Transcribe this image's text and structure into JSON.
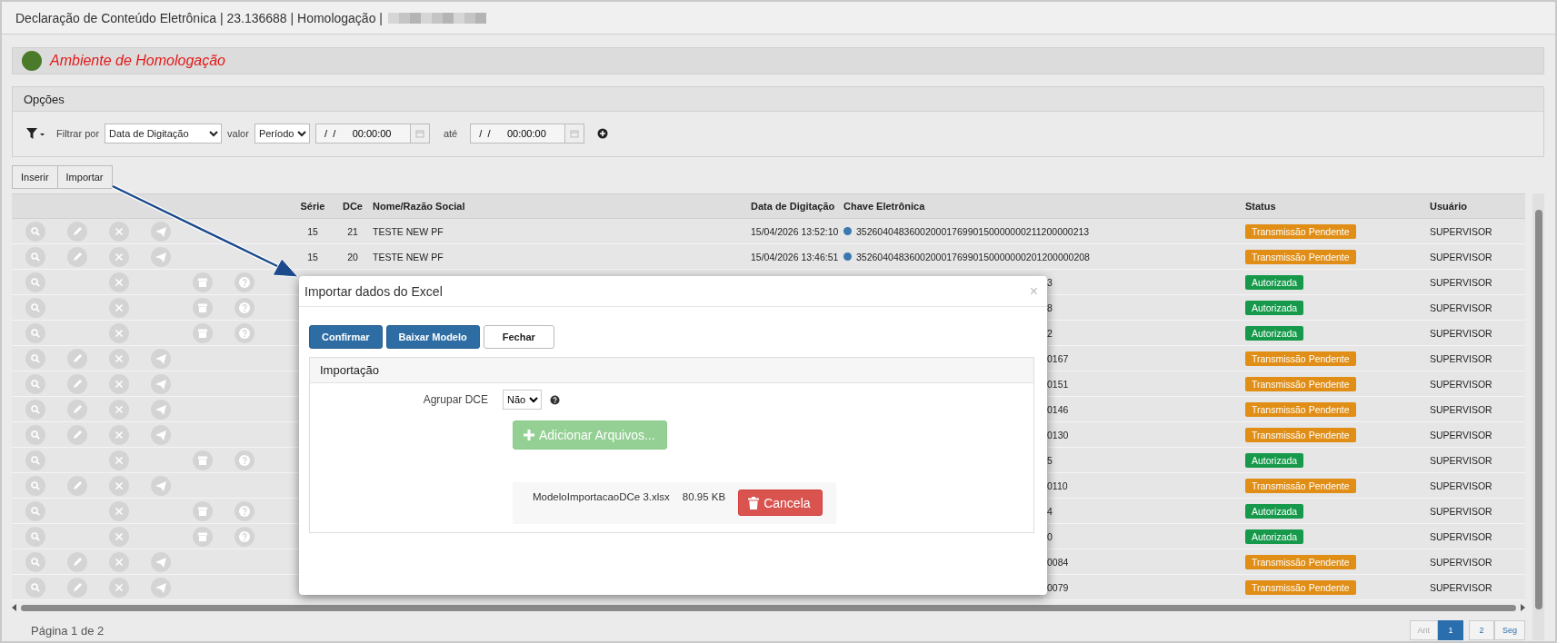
{
  "window": {
    "title": "Declaração de Conteúdo Eletrônica | 23.136688 | Homologação |"
  },
  "environment": {
    "label": "Ambiente de Homologação"
  },
  "options": {
    "title": "Opções",
    "filter_label": "Filtrar por",
    "filter_field": "Data de Digitação",
    "value_label": "valor",
    "value_mode": "Período",
    "from_value": "   /  /      00:00:00",
    "to_label": "até",
    "to_value": "   /  /      00:00:00"
  },
  "toolbar": [
    "Inserir",
    "Importar"
  ],
  "table": {
    "columns": [
      "Série",
      "DCe",
      "Nome/Razão Social",
      "Data de Digitação",
      "Chave Eletrônica",
      "Status",
      "Usuário"
    ],
    "rows": [
      {
        "actions": [
          {
            "kind": "search"
          },
          {
            "kind": "edit"
          },
          {
            "kind": "cancel"
          },
          {
            "kind": "send"
          }
        ],
        "serie": "15",
        "dce": "21",
        "name": "TESTE NEW PF",
        "date": "15/04/2026 13:52:10",
        "key": "35260404836002000176990150000000211200000213",
        "status": {
          "label": "Transmissão Pendente",
          "color": "#e08e16"
        },
        "user": "SUPERVISOR"
      },
      {
        "actions": [
          {
            "kind": "search"
          },
          {
            "kind": "edit"
          },
          {
            "kind": "cancel"
          },
          {
            "kind": "send"
          }
        ],
        "serie": "15",
        "dce": "20",
        "name": "TESTE NEW PF",
        "date": "15/04/2026 13:46:51",
        "key": "35260404836002000176990150000000201200000208",
        "status": {
          "label": "Transmissão Pendente",
          "color": "#e08e16"
        },
        "user": "SUPERVISOR"
      },
      {
        "actions": [
          {
            "kind": "search"
          },
          {
            "kind": "cancel"
          },
          {
            "kind": "archive"
          },
          {
            "kind": "help"
          }
        ],
        "key_tail": "3",
        "status": {
          "label": "Autorizada",
          "color": "#17994b"
        },
        "user": "SUPERVISOR"
      },
      {
        "actions": [
          {
            "kind": "search"
          },
          {
            "kind": "cancel"
          },
          {
            "kind": "archive"
          },
          {
            "kind": "help"
          }
        ],
        "key_tail": "8",
        "status": {
          "label": "Autorizada",
          "color": "#17994b"
        },
        "user": "SUPERVISOR"
      },
      {
        "actions": [
          {
            "kind": "search"
          },
          {
            "kind": "cancel"
          },
          {
            "kind": "archive"
          },
          {
            "kind": "help"
          }
        ],
        "key_tail": "2",
        "status": {
          "label": "Autorizada",
          "color": "#17994b"
        },
        "user": "SUPERVISOR"
      },
      {
        "actions": [
          {
            "kind": "search"
          },
          {
            "kind": "edit"
          },
          {
            "kind": "cancel"
          },
          {
            "kind": "send"
          }
        ],
        "key_tail": "0167",
        "status": {
          "label": "Transmissão Pendente",
          "color": "#e08e16"
        },
        "user": "SUPERVISOR"
      },
      {
        "actions": [
          {
            "kind": "search"
          },
          {
            "kind": "edit"
          },
          {
            "kind": "cancel"
          },
          {
            "kind": "send"
          }
        ],
        "key_tail": "0151",
        "status": {
          "label": "Transmissão Pendente",
          "color": "#e08e16"
        },
        "user": "SUPERVISOR"
      },
      {
        "actions": [
          {
            "kind": "search"
          },
          {
            "kind": "edit"
          },
          {
            "kind": "cancel"
          },
          {
            "kind": "send"
          }
        ],
        "key_tail": "0146",
        "status": {
          "label": "Transmissão Pendente",
          "color": "#e08e16"
        },
        "user": "SUPERVISOR"
      },
      {
        "actions": [
          {
            "kind": "search"
          },
          {
            "kind": "edit"
          },
          {
            "kind": "cancel"
          },
          {
            "kind": "send"
          }
        ],
        "key_tail": "0130",
        "status": {
          "label": "Transmissão Pendente",
          "color": "#e08e16"
        },
        "user": "SUPERVISOR"
      },
      {
        "actions": [
          {
            "kind": "search"
          },
          {
            "kind": "cancel"
          },
          {
            "kind": "archive"
          },
          {
            "kind": "help"
          }
        ],
        "key_tail": "5",
        "status": {
          "label": "Autorizada",
          "color": "#17994b"
        },
        "user": "SUPERVISOR"
      },
      {
        "actions": [
          {
            "kind": "search"
          },
          {
            "kind": "edit"
          },
          {
            "kind": "cancel"
          },
          {
            "kind": "send"
          }
        ],
        "key_tail": "0110",
        "status": {
          "label": "Transmissão Pendente",
          "color": "#e08e16"
        },
        "user": "SUPERVISOR"
      },
      {
        "actions": [
          {
            "kind": "search"
          },
          {
            "kind": "cancel"
          },
          {
            "kind": "archive"
          },
          {
            "kind": "help"
          }
        ],
        "key_tail": "4",
        "status": {
          "label": "Autorizada",
          "color": "#17994b"
        },
        "user": "SUPERVISOR"
      },
      {
        "actions": [
          {
            "kind": "search"
          },
          {
            "kind": "cancel"
          },
          {
            "kind": "archive"
          },
          {
            "kind": "help"
          }
        ],
        "key_tail": "0",
        "status": {
          "label": "Autorizada",
          "color": "#17994b"
        },
        "user": "SUPERVISOR"
      },
      {
        "actions": [
          {
            "kind": "search"
          },
          {
            "kind": "edit"
          },
          {
            "kind": "cancel"
          },
          {
            "kind": "send"
          }
        ],
        "key_tail": "0084",
        "status": {
          "label": "Transmissão Pendente",
          "color": "#e08e16"
        },
        "user": "SUPERVISOR"
      },
      {
        "actions": [
          {
            "kind": "search"
          },
          {
            "kind": "edit"
          },
          {
            "kind": "cancel"
          },
          {
            "kind": "send"
          }
        ],
        "key_tail": "0079",
        "status": {
          "label": "Transmissão Pendente",
          "color": "#e08e16"
        },
        "user": "SUPERVISOR"
      }
    ]
  },
  "footer": {
    "label": "Página 1 de 2",
    "pages": [
      {
        "label": "Ant",
        "selected": false,
        "disabled": true
      },
      {
        "label": "1",
        "selected": true,
        "disabled": false
      },
      {
        "label": "2",
        "selected": false,
        "disabled": false
      },
      {
        "label": "Seg",
        "selected": false,
        "disabled": false
      }
    ]
  },
  "modal": {
    "title": "Importar dados do Excel",
    "close": "×",
    "buttons": [
      {
        "label": "Confirmar",
        "kind": "primary"
      },
      {
        "label": "Baixar Modelo",
        "kind": "primary"
      },
      {
        "label": "Fechar",
        "kind": "default"
      }
    ],
    "section": "Importação",
    "group_label": "Agrupar DCE",
    "group_value": "Não",
    "add_files": {
      "label": "Adicionar Arquivos...",
      "disabled": true
    },
    "file": {
      "name": "ModeloImportacaoDCe 3.xlsx",
      "size": "80.95 KB",
      "cancel": "Cancela"
    }
  }
}
